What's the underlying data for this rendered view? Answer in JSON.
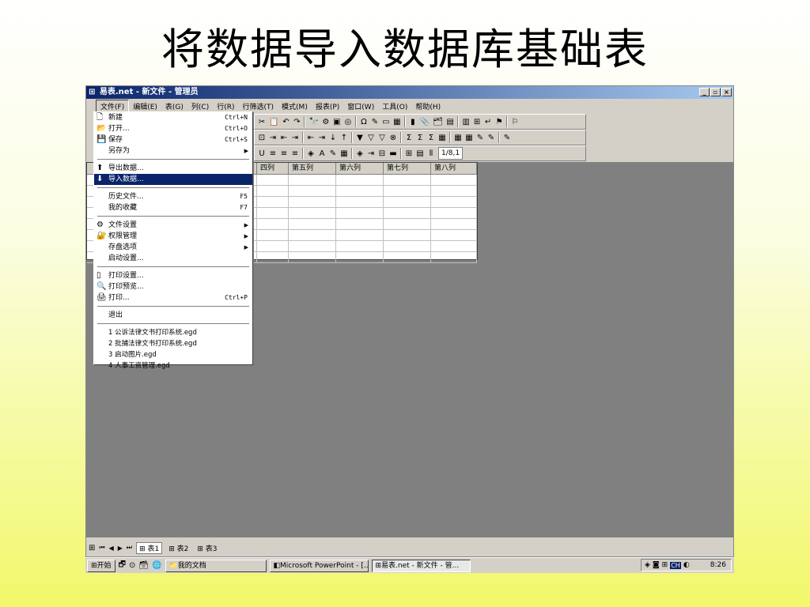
{
  "slide": {
    "title": "将数据导入数据库基础表"
  },
  "window": {
    "title": "易表.net - 新文件 - 管理员",
    "app_icon": "app-table-icon",
    "controls": [
      "_",
      "▫",
      "×"
    ]
  },
  "menubar": [
    "文件(F)",
    "编辑(E)",
    "表(G)",
    "列(C)",
    "行(R)",
    "行筛选(T)",
    "模式(M)",
    "报表(P)",
    "窗口(W)",
    "工具(O)",
    "帮助(H)"
  ],
  "toolbar1": [
    "✂",
    "📋",
    "↶",
    "↷",
    "🔭",
    "⚙",
    "▣",
    "◎",
    "Ω",
    "✎",
    "▭",
    "▦",
    "▮",
    "📎",
    "🗂",
    "▤",
    "▥",
    "⊞",
    "↵",
    "⚑",
    "⚐"
  ],
  "toolbar2": [
    "⊡",
    "⇥",
    "⇤",
    "⇥",
    "⇤",
    "⇥",
    "↓",
    "↑",
    "▼",
    "▽",
    "▽",
    "⊗",
    "Σ",
    "Σ",
    "Σ",
    "▦",
    "▦",
    "▦",
    "✎",
    "✎",
    "✎"
  ],
  "toolbar3": {
    "icons": [
      "U",
      "≡",
      "≡",
      "≡",
      "◈",
      "A",
      "✎",
      "▦",
      "◈",
      "⇥",
      "⊟",
      "▬",
      "⊞",
      "▤",
      "⫴"
    ],
    "cell_ref": "1/8,1"
  },
  "grid": {
    "columns": [
      "四列",
      "第五列",
      "第六列",
      "第七列",
      "第八列"
    ]
  },
  "file_menu": {
    "items": [
      {
        "icon": "🗋",
        "label": "新建",
        "shortcut": "Ctrl+N"
      },
      {
        "icon": "📂",
        "label": "打开...",
        "shortcut": "Ctrl+O"
      },
      {
        "icon": "💾",
        "label": "保存",
        "shortcut": "Ctrl+S"
      },
      {
        "icon": "",
        "label": "另存为",
        "submenu": true
      }
    ],
    "items2": [
      {
        "icon": "⬆",
        "label": "导出数据..."
      },
      {
        "icon": "⬇",
        "label": "导入数据...",
        "highlighted": true
      }
    ],
    "items3": [
      {
        "label": "历史文件...",
        "shortcut": "F5"
      },
      {
        "label": "我的收藏",
        "shortcut": "F7"
      }
    ],
    "items4": [
      {
        "icon": "⚙",
        "label": "文件设置",
        "submenu": true
      },
      {
        "icon": "🔐",
        "label": "权限管理",
        "submenu": true
      },
      {
        "icon": "",
        "label": "存盘选项",
        "submenu": true
      },
      {
        "icon": "",
        "label": "启动设置..."
      }
    ],
    "items5": [
      {
        "icon": "▯",
        "label": "打印设置..."
      },
      {
        "icon": "🔍",
        "label": "打印预览..."
      },
      {
        "icon": "🖨",
        "label": "打印...",
        "shortcut": "Ctrl+P"
      }
    ],
    "exit": "退出",
    "recent": [
      "1 公诉法律文书打印系统.egd",
      "2 批捕法律文书打印系统.egd",
      "3 启动图片.egd",
      "4 人事工资管理.egd"
    ]
  },
  "sheets": {
    "nav": [
      "⏮",
      "◀",
      "▶",
      "⏭"
    ],
    "tabs": [
      "表1",
      "表2",
      "表3"
    ]
  },
  "taskbar": {
    "start": "开始",
    "quick_launch": [
      "🗗",
      "⊙",
      "🗃",
      "🌐"
    ],
    "buttons": [
      "我的文档",
      "Microsoft PowerPoint - [...",
      "易表.net - 新文件 - 管..."
    ],
    "tray_icons": [
      "◈",
      "◙",
      "⊞",
      "CH",
      "◐"
    ],
    "clock": "8:26"
  }
}
